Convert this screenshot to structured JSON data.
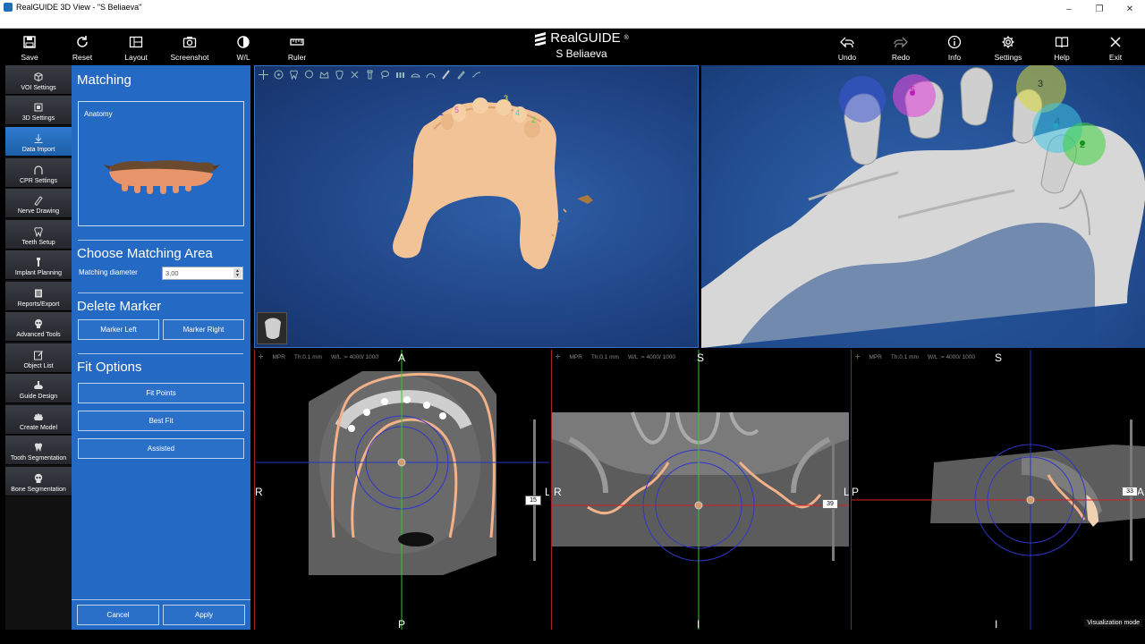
{
  "window": {
    "title": "RealGUIDE 3D View - \"S Beliaeva\"",
    "controls": [
      "–",
      "❐",
      "✕"
    ]
  },
  "brand": {
    "name": "RealGUIDE",
    "mark": "®",
    "patient": "S Beliaeva"
  },
  "toolbar": {
    "save": "Save",
    "reset": "Reset",
    "layout": "Layout",
    "screenshot": "Screenshot",
    "wl": "W/L",
    "ruler": "Ruler",
    "undo": "Undo",
    "redo": "Redo",
    "info": "Info",
    "settings": "Settings",
    "help": "Help",
    "exit": "Exit"
  },
  "leftnav": {
    "items": [
      {
        "label": "VOI Settings"
      },
      {
        "label": "3D Settings"
      },
      {
        "label": "Data Import"
      },
      {
        "label": "CPR Settings"
      },
      {
        "label": "Nerve Drawing"
      },
      {
        "label": "Teeth Setup"
      },
      {
        "label": "Implant Planning"
      },
      {
        "label": "Reports/Export"
      },
      {
        "label": "Advanced Tools"
      },
      {
        "label": "Object List"
      },
      {
        "label": "Guide Design"
      },
      {
        "label": "Create Model"
      },
      {
        "label": "Tooth Segmentation"
      },
      {
        "label": "Bone Segmentation"
      }
    ],
    "active_index": 2
  },
  "panel": {
    "title": "Matching",
    "anatomy_label": "Anatomy",
    "choose_area": {
      "heading": "Choose Matching Area",
      "diameter_label": "Matching diameter",
      "diameter_value": "3,00"
    },
    "delete_marker": {
      "heading": "Delete Marker",
      "left": "Marker Left",
      "right": "Marker Right"
    },
    "fit_options": {
      "heading": "Fit Options",
      "fit_points": "Fit Points",
      "best_fit": "Best Fit",
      "assisted": "Assisted"
    },
    "cancel": "Cancel",
    "apply": "Apply"
  },
  "markers_small": [
    "1",
    "5",
    "3",
    "4",
    "2"
  ],
  "markers_large": [
    "5",
    "3",
    "4",
    "2"
  ],
  "viewports": {
    "axial": {
      "mode": "MPR",
      "thickness": "Th:0.1 mm",
      "wl": "W/L := 4000/ 1000",
      "top": "A",
      "bottom": "P",
      "left": "R",
      "right": "L",
      "slice": "15"
    },
    "cpr": {
      "mode": "MPR",
      "thickness": "Th:0.1 mm",
      "wl": "W/L := 4000/ 1000",
      "top": "S",
      "bottom": "I",
      "left": "R",
      "right": "L",
      "slice": "39"
    },
    "sagittal": {
      "mode": "MPR",
      "thickness": "Th:0.1 mm",
      "wl": "W/L := 4000/ 1000",
      "top": "S",
      "bottom": "I",
      "left": "P",
      "right": "A",
      "slice": "33"
    }
  },
  "status": {
    "visualization_mode": "Visualization mode"
  }
}
